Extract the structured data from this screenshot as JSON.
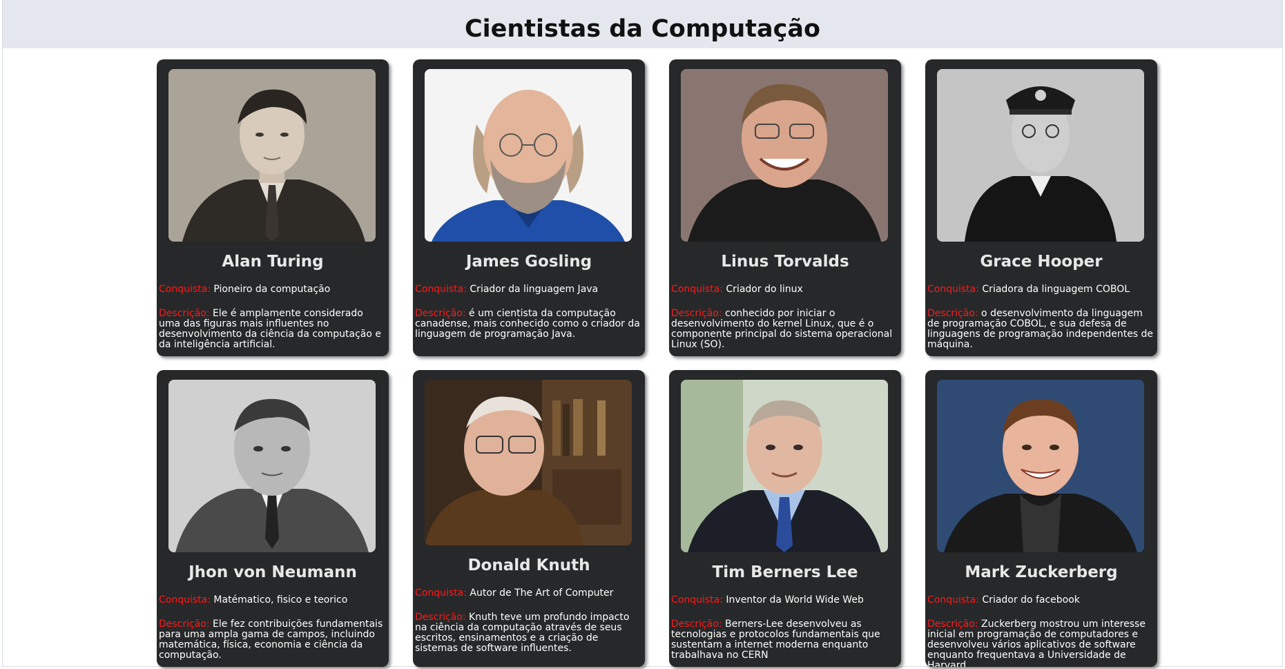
{
  "header": {
    "title": "Cientistas da Computação"
  },
  "labels": {
    "conquista": "Conquista:",
    "descricao": "Descrição:"
  },
  "cards": [
    {
      "name": "Alan Turing",
      "conquista": "Pioneiro da computação",
      "descricao": "Ele é amplamente considerado uma das figuras mais influentes no desenvolvimento da ciência da computação e da inteligência artificial."
    },
    {
      "name": "James Gosling",
      "conquista": "Criador da linguagem Java",
      "descricao": "é um cientista da computação canadense, mais conhecido como o criador da linguagem de programação Java."
    },
    {
      "name": "Linus Torvalds",
      "conquista": "Criador do linux",
      "descricao": "conhecido por iniciar o desenvolvimento do kernel Linux, que é o componente principal do sistema operacional Linux (SO)."
    },
    {
      "name": "Grace Hooper",
      "conquista": "Criadora da linguagem COBOL",
      "descricao": "o desenvolvimento da linguagem de programação COBOL, e sua defesa de linguagens de programação independentes de máquina."
    },
    {
      "name": "Jhon von Neumann",
      "conquista": "Matématico, fisico e teorico",
      "descricao": "Ele fez contribuições fundamentais para uma ampla gama de campos, incluindo matemática, física, economia e ciência da computação."
    },
    {
      "name": "Donald Knuth",
      "conquista": "Autor de The Art of Computer",
      "descricao": "Knuth teve um profundo impacto na ciência da computação através de seus escritos, ensinamentos e a criação de sistemas de software influentes."
    },
    {
      "name": "Tim Berners Lee",
      "conquista": "Inventor da World Wide Web",
      "descricao": "Berners-Lee desenvolveu as tecnologias e protocolos fundamentais que sustentam a internet moderna enquanto trabalhava no CERN"
    },
    {
      "name": "Mark Zuckerberg",
      "conquista": "Criador do facebook",
      "descricao": "Zuckerberg mostrou um interesse inicial em programação de computadores e desenvolveu vários aplicativos de software enquanto frequentava a Universidade de Harvard."
    }
  ]
}
